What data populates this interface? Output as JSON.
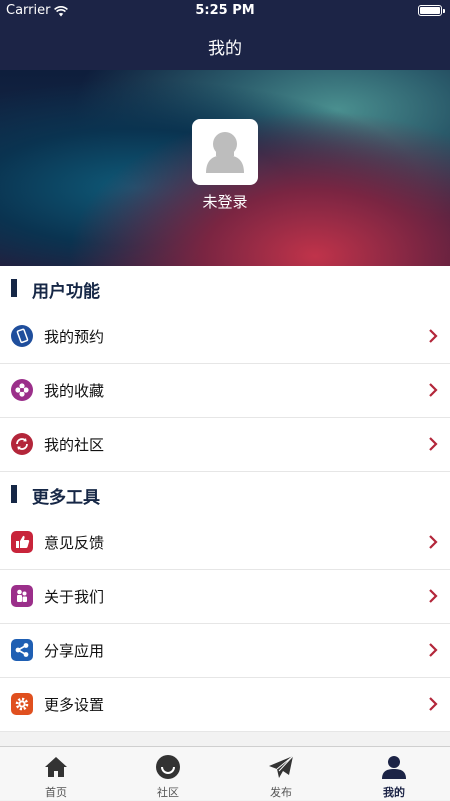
{
  "status_bar": {
    "carrier": "Carrier",
    "time": "5:25 PM"
  },
  "nav": {
    "title": "我的"
  },
  "profile": {
    "login_status": "未登录"
  },
  "sections": [
    {
      "title": "用户功能",
      "items": [
        {
          "label": "我的预约",
          "icon": "phone-icon",
          "color": "#1f4e9c"
        },
        {
          "label": "我的收藏",
          "icon": "flower-icon",
          "color": "#9b2f8a"
        },
        {
          "label": "我的社区",
          "icon": "refresh-icon",
          "color": "#b3263a"
        }
      ]
    },
    {
      "title": "更多工具",
      "items": [
        {
          "label": "意见反馈",
          "icon": "thumbs-up-icon",
          "color": "#c8243a"
        },
        {
          "label": "关于我们",
          "icon": "people-icon",
          "color": "#9b2f8a"
        },
        {
          "label": "分享应用",
          "icon": "share-icon",
          "color": "#1f5fb3"
        },
        {
          "label": "更多设置",
          "icon": "gear-icon",
          "color": "#e0501f"
        }
      ]
    }
  ],
  "tabs": [
    {
      "label": "首页",
      "icon": "home-icon"
    },
    {
      "label": "社区",
      "icon": "smile-icon"
    },
    {
      "label": "发布",
      "icon": "paper-plane-icon"
    },
    {
      "label": "我的",
      "icon": "user-icon",
      "active": true
    }
  ],
  "colors": {
    "nav_bg": "#1c2446",
    "accent": "#162746",
    "chevron": "#b3263a"
  }
}
